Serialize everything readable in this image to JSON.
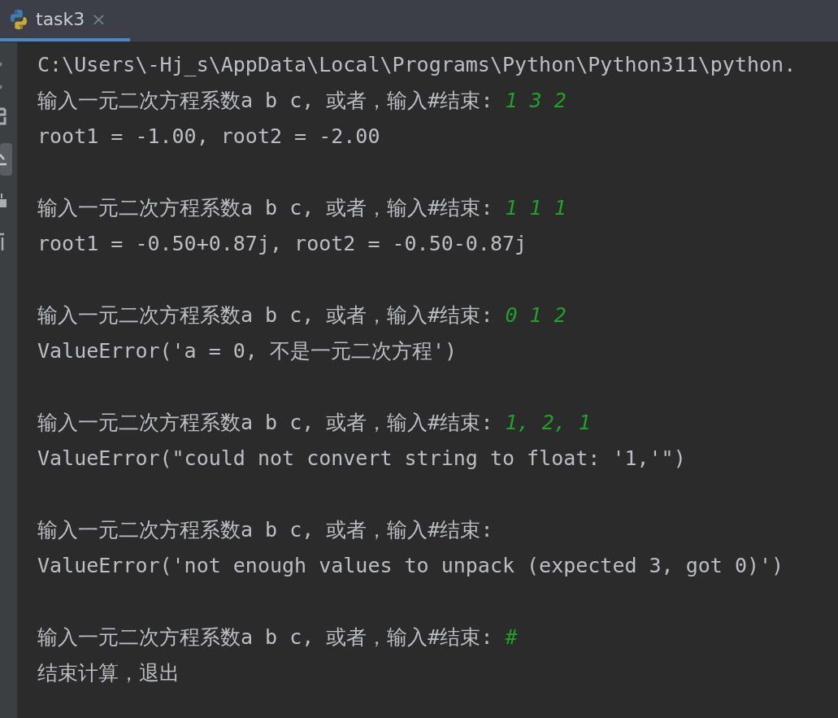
{
  "tab": {
    "title": "task3",
    "close": "×",
    "selected": true
  },
  "console": [
    {
      "kind": "output",
      "text": "C:\\Users\\-Hj_s\\AppData\\Local\\Programs\\Python\\Python311\\python."
    },
    {
      "kind": "prompt",
      "text": "输入一元二次方程系数a b c, 或者，输入#结束: ",
      "input": "1 3 2"
    },
    {
      "kind": "output",
      "text": "root1 = -1.00, root2 = -2.00"
    },
    {
      "kind": "blank"
    },
    {
      "kind": "prompt",
      "text": "输入一元二次方程系数a b c, 或者，输入#结束: ",
      "input": "1 1 1"
    },
    {
      "kind": "output",
      "text": "root1 = -0.50+0.87j, root2 = -0.50-0.87j"
    },
    {
      "kind": "blank"
    },
    {
      "kind": "prompt",
      "text": "输入一元二次方程系数a b c, 或者，输入#结束: ",
      "input": "0 1 2"
    },
    {
      "kind": "output",
      "text": "ValueError('a = 0, 不是一元二次方程')"
    },
    {
      "kind": "blank"
    },
    {
      "kind": "prompt",
      "text": "输入一元二次方程系数a b c, 或者，输入#结束: ",
      "input": "1, 2, 1"
    },
    {
      "kind": "output",
      "text": "ValueError(\"could not convert string to float: '1,'\")"
    },
    {
      "kind": "blank"
    },
    {
      "kind": "prompt",
      "text": "输入一元二次方程系数a b c, 或者，输入#结束:"
    },
    {
      "kind": "output",
      "text": "ValueError('not enough values to unpack (expected 3, got 0)')"
    },
    {
      "kind": "blank"
    },
    {
      "kind": "prompt",
      "text": "输入一元二次方程系数a b c, 或者，输入#结束: ",
      "input": "#"
    },
    {
      "kind": "output",
      "text": "结束计算，退出"
    }
  ]
}
